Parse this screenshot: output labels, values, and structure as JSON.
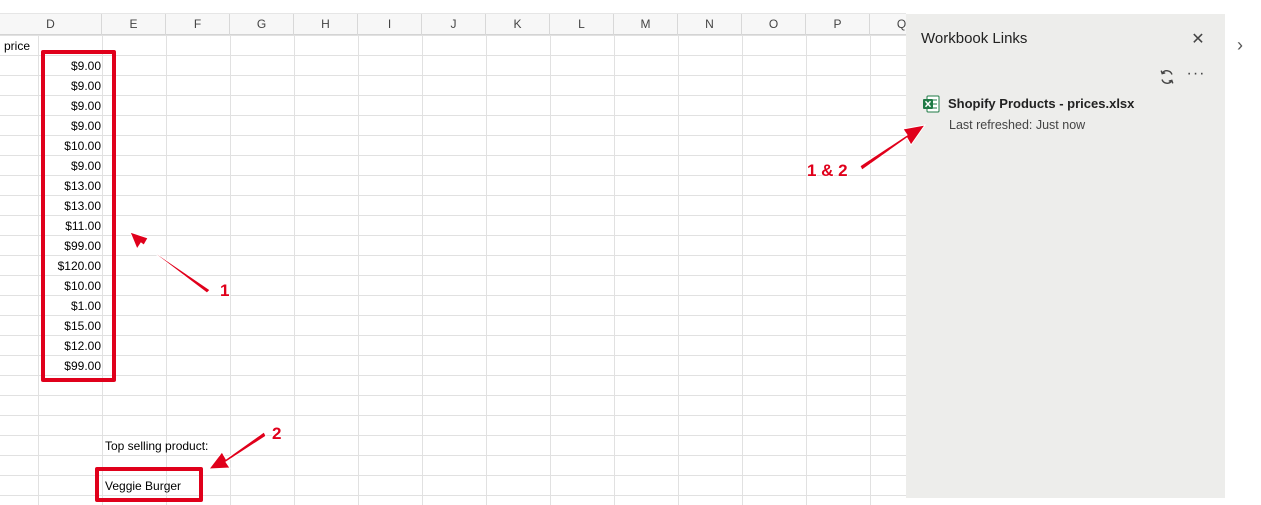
{
  "columns": [
    "D",
    "E",
    "F",
    "G",
    "H",
    "I",
    "J",
    "K",
    "L",
    "M",
    "N",
    "O",
    "P",
    "Q"
  ],
  "sheet": {
    "price_header": "price",
    "prices": [
      "$9.00",
      "$9.00",
      "$9.00",
      "$9.00",
      "$10.00",
      "$9.00",
      "$13.00",
      "$13.00",
      "$11.00",
      "$99.00",
      "$120.00",
      "$10.00",
      "$1.00",
      "$15.00",
      "$12.00",
      "$99.00"
    ],
    "top_selling_label": "Top selling product:",
    "top_selling_value": "Veggie Burger"
  },
  "panel": {
    "title": "Workbook Links",
    "close_icon": "close-icon",
    "refresh_icon": "refresh-icon",
    "more_icon": "more-options-icon",
    "link": {
      "name": "Shopify Products - prices.xlsx",
      "status": "Last refreshed: Just now",
      "icon": "excel-file-icon"
    }
  },
  "annotations": {
    "label_1": "1",
    "label_2": "2",
    "label_1_2": "1 & 2",
    "color": "#e0001b"
  },
  "colors": {
    "panel_bg": "#ededeb",
    "grid_line": "#e1e1e1",
    "header_bg": "#f7f7f7",
    "excel_green": "#1f7a45"
  }
}
